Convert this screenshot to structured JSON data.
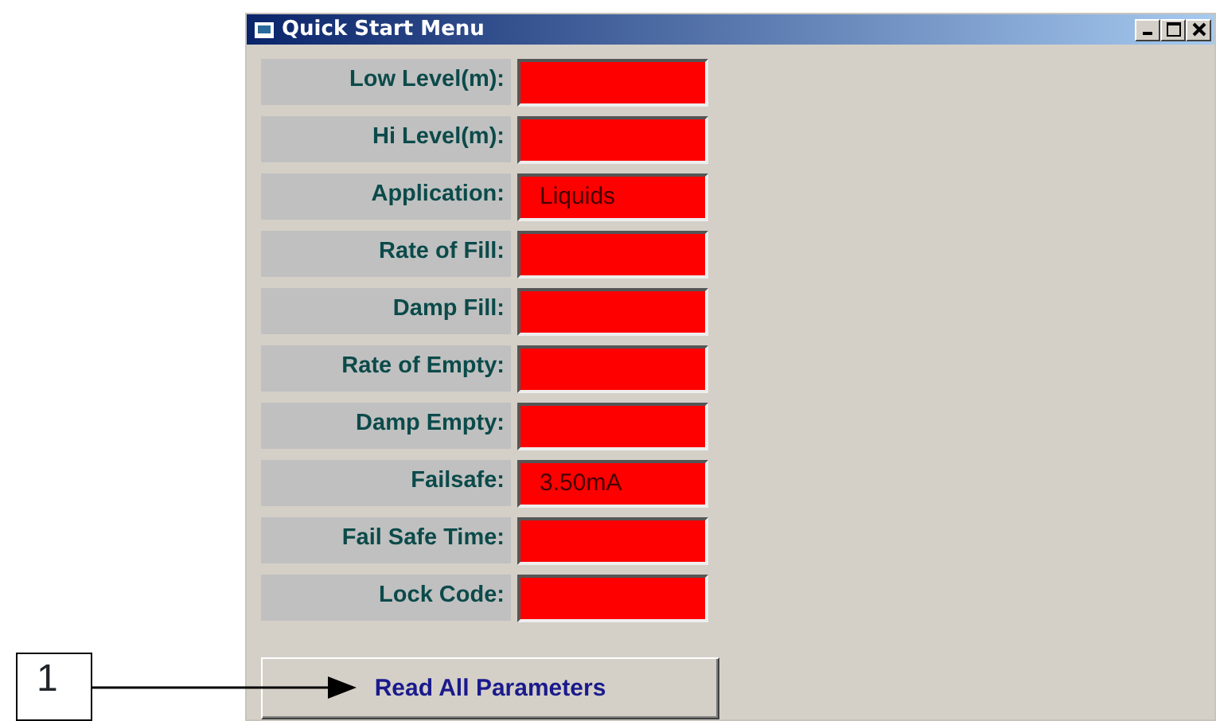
{
  "window": {
    "title": "Quick Start Menu"
  },
  "fields": [
    {
      "label": "Low Level(m):"
    },
    {
      "label": "Hi Level(m):"
    },
    {
      "label": "Application:",
      "value": "Liquids"
    },
    {
      "label": "Rate of Fill:"
    },
    {
      "label": "Damp Fill:"
    },
    {
      "label": "Rate of Empty:"
    },
    {
      "label": "Damp Empty:"
    },
    {
      "label": "Failsafe:",
      "value": "3.50mA"
    },
    {
      "label": "Fail Safe Time:"
    },
    {
      "label": "Lock Code:"
    }
  ],
  "button": "Read All Parameters",
  "callout": {
    "label": "1"
  }
}
